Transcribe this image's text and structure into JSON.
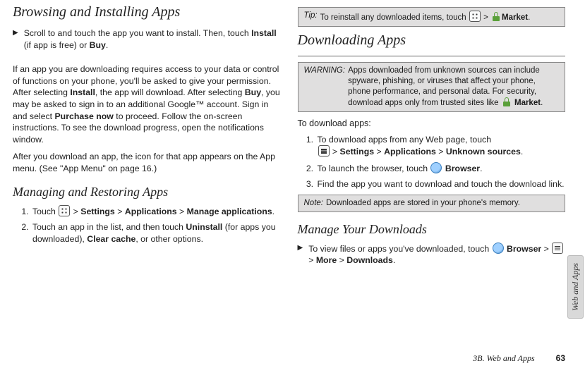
{
  "left": {
    "h1": "Browsing and Installing Apps",
    "bullet1": "Scroll to and touch the app you want to install. Then, touch ",
    "bullet1_b1": "Install",
    "bullet1_mid": " (if app is free) or ",
    "bullet1_b2": "Buy",
    "bullet1_end": ".",
    "p1a": "If an app you are downloading requires access to your data or control of functions on your phone, you'll be asked to give your permission. After selecting ",
    "p1b": "Install",
    "p1c": ", the app will download. After selecting ",
    "p1d": "Buy",
    "p1e": ", you may be asked to sign in to an additional Google™ account. Sign in and select ",
    "p1f": "Purchase now",
    "p1g": " to proceed. Follow the on-screen instructions. To see the download progress, open the notifications window.",
    "p2": "After you download an app, the icon for that app appears on the App menu. (See \"App Menu\" on page 16.)",
    "h2": "Managing and Restoring Apps",
    "ol1_a": "Touch ",
    "ol1_settings": "Settings",
    "ol1_apps": "Applications",
    "ol1_manage": "Manage applications",
    "ol2_a": "Touch an app in the list, and then touch ",
    "ol2_b": "Uninstall",
    "ol2_c": " (for apps you downloaded), ",
    "ol2_d": "Clear cache",
    "ol2_e": ", or other options."
  },
  "right": {
    "tip_label": "Tip:",
    "tip_a": "To reinstall any downloaded items, touch ",
    "tip_market": "Market",
    "h1": "Downloading Apps",
    "warn_label": "WARNING:",
    "warn_a": "Apps downloaded from unknown sources can include spyware, phishing, or viruses that affect your phone, phone performance, and personal data. For security, download apps only from trusted sites like ",
    "warn_market": "Market",
    "subhead": "To download apps:",
    "ol1_a": "To download apps from any Web page, touch ",
    "ol1_settings": "Settings",
    "ol1_apps": "Applications",
    "ol1_unknown": "Unknown sources",
    "ol2_a": "To launch the browser, touch ",
    "ol2_browser": "Browser",
    "ol3": "Find the app you want to download and touch the download link.",
    "note_label": "Note:",
    "note_body": "Downloaded apps are stored in your phone's memory.",
    "h2": "Manage Your Downloads",
    "bullet_a": "To view files or apps you've downloaded, touch ",
    "bullet_browser": "Browser",
    "bullet_more": "More",
    "bullet_dl": "Downloads"
  },
  "gt": ">",
  "side_tab": "Web and Apps",
  "footer_section": "3B. Web and Apps",
  "footer_page": "63"
}
